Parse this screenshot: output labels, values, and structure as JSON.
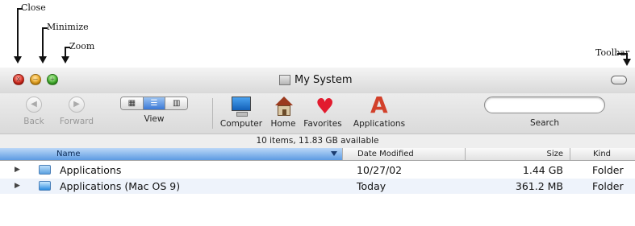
{
  "annotations": {
    "close": "Close",
    "minimize": "Minimize",
    "zoom": "Zoom",
    "toolbar": "Toolbar"
  },
  "window": {
    "title": "My System",
    "controls": {
      "close_glyph": "x",
      "minimize_glyph": "–",
      "zoom_glyph": "+"
    }
  },
  "toolbar": {
    "back_label": "Back",
    "forward_label": "Forward",
    "view_label": "View",
    "view_modes": [
      "icon",
      "list",
      "column"
    ],
    "view_selected": "list",
    "computer_label": "Computer",
    "home_label": "Home",
    "favorites_label": "Favorites",
    "applications_label": "Applications",
    "search_label": "Search",
    "search_value": ""
  },
  "status": {
    "text": "10 items, 11.83 GB available"
  },
  "columns": {
    "name": "Name",
    "date": "Date Modified",
    "size": "Size",
    "kind": "Kind"
  },
  "rows": [
    {
      "name": "Applications",
      "date": "10/27/02",
      "size": "1.44 GB",
      "kind": "Folder"
    },
    {
      "name": "Applications (Mac OS 9)",
      "date": "Today",
      "size": "361.2 MB",
      "kind": "Folder"
    }
  ],
  "colors": {
    "accent": "#5d9be3",
    "close": "#e0291b",
    "minimize": "#f2a91c",
    "zoom": "#41b72b"
  }
}
